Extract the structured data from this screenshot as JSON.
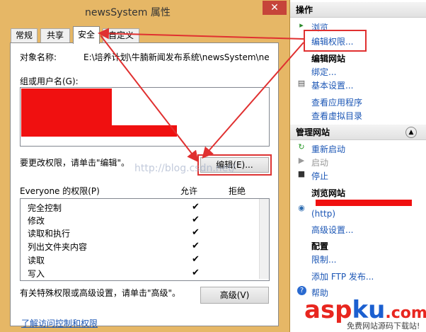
{
  "dialog": {
    "title": "newsSystem 属性",
    "close_icon": "close-icon",
    "tabs": [
      "常规",
      "共享",
      "安全",
      "自定义"
    ],
    "active_tab": "安全",
    "object_label": "对象名称:",
    "object_value": "E:\\培养计划\\牛腩新闻发布系统\\newsSystem\\newsS",
    "group_label": "组或用户名(G):",
    "change_hint": "要更改权限，请单击\"编辑\"。",
    "edit_button": "编辑(E)...",
    "perm_title": "Everyone 的权限(P)",
    "allow_col": "允许",
    "deny_col": "拒绝",
    "permissions": [
      {
        "name": "完全控制",
        "allow": "✔"
      },
      {
        "name": "修改",
        "allow": "✔"
      },
      {
        "name": "读取和执行",
        "allow": "✔"
      },
      {
        "name": "列出文件夹内容",
        "allow": "✔"
      },
      {
        "name": "读取",
        "allow": "✔"
      },
      {
        "name": "写入",
        "allow": "✔"
      }
    ],
    "special_hint": "有关特殊权限或高级设置，请单击\"高级\"。",
    "advanced_button": "高级(V)",
    "bottom_link": "了解访问控制和权限"
  },
  "actions": {
    "header": "操作",
    "browse": "浏览",
    "edit_permissions": "编辑权限...",
    "edit_site": "编辑网站",
    "bindings": "绑定...",
    "basic_settings": "基本设置...",
    "view_apps": "查看应用程序",
    "view_vdirs": "查看虚拟目录",
    "manage_header": "管理网站",
    "restart": "重新启动",
    "start": "启动",
    "stop": "停止",
    "browse_site": "浏览网站",
    "http": "(http)",
    "advanced_settings": "高级设置...",
    "config": "配置",
    "limits": "限制...",
    "add_ftp": "添加 FTP 发布...",
    "help": "帮助"
  },
  "watermark": "http://blog.csdn.net/",
  "logo": {
    "asp": "asp",
    "ku": "ku",
    "com": ".com",
    "sub": "免费网站源码下载站!"
  },
  "colors": {
    "accent_red": "#e03030",
    "link_blue": "#1b56b5",
    "frame": "#e6b766"
  }
}
